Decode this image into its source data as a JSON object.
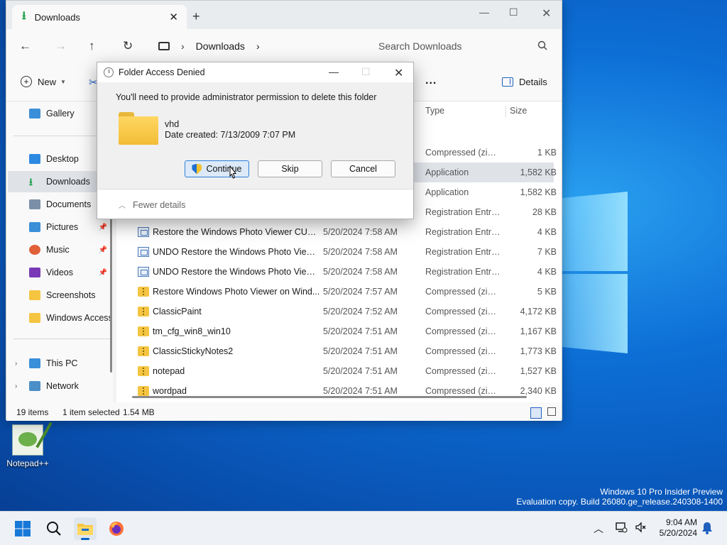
{
  "explorer": {
    "tab_title": "Downloads",
    "tab_add": "+",
    "address_crumb": "Downloads",
    "address_sep": "›",
    "address_sep_end": "›",
    "search_placeholder": "Search Downloads",
    "cmd_new": "New",
    "cmd_more": "...",
    "cmd_details": "Details",
    "columns": {
      "type": "Type",
      "size": "Size"
    },
    "sidebar": {
      "gallery": "Gallery",
      "desktop": "Desktop",
      "downloads": "Downloads",
      "documents": "Documents",
      "pictures": "Pictures",
      "music": "Music",
      "videos": "Videos",
      "screenshots": "Screenshots",
      "windows_access": "Windows Access",
      "this_pc": "This PC",
      "network": "Network"
    },
    "hidden_rows": [
      {
        "type": "Compressed (zipp...",
        "size": "1 KB"
      },
      {
        "type": "Application",
        "size": "1,582 KB"
      },
      {
        "type": "Application",
        "size": "1,582 KB"
      },
      {
        "type": "Registration Entries",
        "size": "28 KB"
      }
    ],
    "rows": [
      {
        "name": "Restore the Windows Photo Viewer CURR...",
        "date": "5/20/2024 7:58 AM",
        "type": "Registration Entries",
        "size": "4 KB"
      },
      {
        "name": "UNDO Restore the Windows Photo Viewe...",
        "date": "5/20/2024 7:58 AM",
        "type": "Registration Entries",
        "size": "7 KB"
      },
      {
        "name": "UNDO Restore the Windows Photo Viewe...",
        "date": "5/20/2024 7:58 AM",
        "type": "Registration Entries",
        "size": "4 KB"
      },
      {
        "name": "Restore Windows Photo Viewer on Wind...",
        "date": "5/20/2024 7:57 AM",
        "type": "Compressed (zipp...",
        "size": "5 KB"
      },
      {
        "name": "ClassicPaint",
        "date": "5/20/2024 7:52 AM",
        "type": "Compressed (zipp...",
        "size": "4,172 KB"
      },
      {
        "name": "tm_cfg_win8_win10",
        "date": "5/20/2024 7:51 AM",
        "type": "Compressed (zipp...",
        "size": "1,167 KB"
      },
      {
        "name": "ClassicStickyNotes2",
        "date": "5/20/2024 7:51 AM",
        "type": "Compressed (zipp...",
        "size": "1,773 KB"
      },
      {
        "name": "notepad",
        "date": "5/20/2024 7:51 AM",
        "type": "Compressed (zipp...",
        "size": "1,527 KB"
      },
      {
        "name": "wordpad",
        "date": "5/20/2024 7:51 AM",
        "type": "Compressed (zipp...",
        "size": "2,340 KB"
      }
    ],
    "status": {
      "count": "19 items",
      "selected": "1 item selected",
      "size": "1.54 MB"
    }
  },
  "dialog": {
    "title": "Folder Access Denied",
    "message": "You'll need to provide administrator permission to delete this folder",
    "folder_name": "vhd",
    "folder_date": "Date created: 7/13/2009 7:07 PM",
    "continue": "Continue",
    "skip": "Skip",
    "cancel": "Cancel",
    "fewer_details": "Fewer details"
  },
  "desktop": {
    "icon_label": "Notepad++",
    "watermark_line1": "Windows 10 Pro Insider Preview",
    "watermark_line2": "Evaluation copy. Build 26080.ge_release.240308-1400"
  },
  "taskbar": {
    "time": "9:04 AM",
    "date": "5/20/2024"
  },
  "colors": {
    "accent": "#1f5fbf",
    "folder": "#f5c542",
    "desktop_bg": "#0d6fd6"
  }
}
